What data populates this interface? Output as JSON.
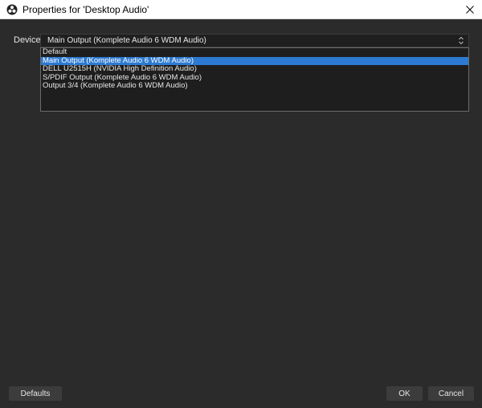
{
  "window": {
    "title": "Properties for 'Desktop Audio'",
    "app_icon": "obs-logo-icon",
    "close_icon": "close-icon"
  },
  "device": {
    "label": "Device",
    "selected_value": "Main Output (Komplete Audio 6 WDM Audio)",
    "arrow_icon": "updown-arrows-icon",
    "options": [
      {
        "label": "Default",
        "selected": false
      },
      {
        "label": "Main Output (Komplete Audio 6 WDM Audio)",
        "selected": true
      },
      {
        "label": "DELL U2515H (NVIDIA High Definition Audio)",
        "selected": false
      },
      {
        "label": "S/PDIF Output (Komplete Audio 6 WDM Audio)",
        "selected": false
      },
      {
        "label": "Output 3/4 (Komplete Audio 6 WDM Audio)",
        "selected": false
      }
    ]
  },
  "buttons": {
    "defaults": "Defaults",
    "ok": "OK",
    "cancel": "Cancel"
  },
  "colors": {
    "background": "#2b2b2b",
    "selection": "#2d7ad2",
    "text": "#e6e6e6"
  }
}
